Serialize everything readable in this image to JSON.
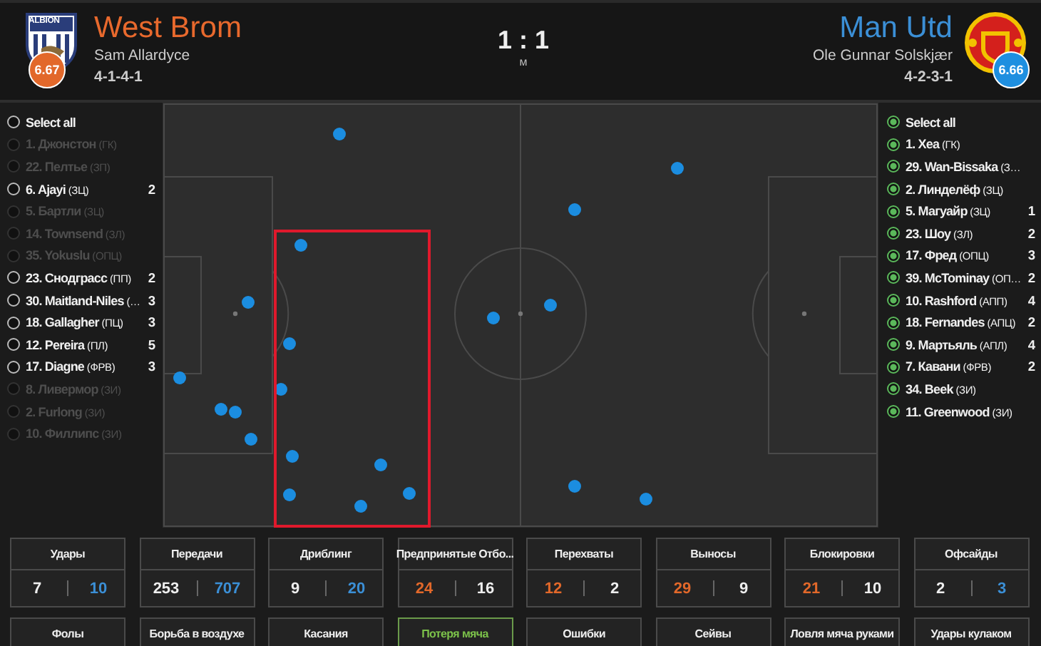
{
  "header": {
    "home": {
      "name": "West Brom",
      "coach": "Sam Allardyce",
      "formation": "4-1-4-1",
      "rating": "6.67",
      "logo_text": "ALBION"
    },
    "score": "1 : 1",
    "period": "м",
    "away": {
      "name": "Man Utd",
      "coach": "Ole Gunnar Solskjær",
      "formation": "4-2-3-1",
      "rating": "6.66"
    }
  },
  "home_players": [
    {
      "name": "Select all",
      "checked": false,
      "disabled": false
    },
    {
      "name": "1. Джонстон",
      "position": "(ГК)",
      "checked": false,
      "disabled": true
    },
    {
      "name": "22. Пелтье",
      "position": "(ЗП)",
      "checked": false,
      "disabled": true
    },
    {
      "name": "6. Ajayi",
      "position": "(ЗЦ)",
      "count": "2",
      "checked": false,
      "disabled": false
    },
    {
      "name": "5. Бартли",
      "position": "(ЗЦ)",
      "checked": false,
      "disabled": true
    },
    {
      "name": "14. Townsend",
      "position": "(ЗЛ)",
      "checked": false,
      "disabled": true
    },
    {
      "name": "35. Yokuslu",
      "position": "(ОПЦ)",
      "checked": false,
      "disabled": true
    },
    {
      "name": "23. Снодграсс",
      "position": "(ПП)",
      "count": "2",
      "checked": false,
      "disabled": false
    },
    {
      "name": "30. Maitland-Niles",
      "position": "(…",
      "count": "3",
      "checked": false,
      "disabled": false
    },
    {
      "name": "18. Gallagher",
      "position": "(ПЦ)",
      "count": "3",
      "checked": false,
      "disabled": false
    },
    {
      "name": "12. Pereira",
      "position": "(ПЛ)",
      "count": "5",
      "checked": false,
      "disabled": false
    },
    {
      "name": "17. Diagne",
      "position": "(ФРВ)",
      "count": "3",
      "checked": false,
      "disabled": false
    },
    {
      "name": "8. Ливермор",
      "position": "(ЗИ)",
      "checked": false,
      "disabled": true
    },
    {
      "name": "2. Furlong",
      "position": "(ЗИ)",
      "checked": false,
      "disabled": true
    },
    {
      "name": "10. Филлипс",
      "position": "(ЗИ)",
      "checked": false,
      "disabled": true
    }
  ],
  "away_players": [
    {
      "name": "Select all",
      "checked": true,
      "disabled": false
    },
    {
      "name": "1. Хеа",
      "position": "(ГК)",
      "checked": true,
      "disabled": false
    },
    {
      "name": "29. Wan-Bissaka",
      "position": "(З…",
      "checked": true,
      "disabled": false
    },
    {
      "name": "2. Линделёф",
      "position": "(ЗЦ)",
      "checked": true,
      "disabled": false
    },
    {
      "name": "5. Магуайр",
      "position": "(ЗЦ)",
      "count": "1",
      "checked": true,
      "disabled": false
    },
    {
      "name": "23. Шоу",
      "position": "(ЗЛ)",
      "count": "2",
      "checked": true,
      "disabled": false
    },
    {
      "name": "17. Фред",
      "position": "(ОПЦ)",
      "count": "3",
      "checked": true,
      "disabled": false
    },
    {
      "name": "39. McTominay",
      "position": "(ОП…",
      "count": "2",
      "checked": true,
      "disabled": false
    },
    {
      "name": "10. Rashford",
      "position": "(АПП)",
      "count": "4",
      "checked": true,
      "disabled": false
    },
    {
      "name": "18. Fernandes",
      "position": "(АПЦ)",
      "count": "2",
      "checked": true,
      "disabled": false
    },
    {
      "name": "9. Мартьяль",
      "position": "(АПЛ)",
      "count": "4",
      "checked": true,
      "disabled": false
    },
    {
      "name": "7. Кавани",
      "position": "(ФРВ)",
      "count": "2",
      "checked": true,
      "disabled": false
    },
    {
      "name": "34. Beek",
      "position": "(ЗИ)",
      "checked": true,
      "disabled": false
    },
    {
      "name": "11. Greenwood",
      "position": "(ЗИ)",
      "checked": true,
      "disabled": false
    }
  ],
  "stats": [
    {
      "title": "Удары",
      "home": "7",
      "away": "10",
      "home_lead": false,
      "away_lead": true,
      "selected": false
    },
    {
      "title": "Передачи",
      "home": "253",
      "away": "707",
      "home_lead": false,
      "away_lead": true,
      "selected": false
    },
    {
      "title": "Дриблинг",
      "home": "9",
      "away": "20",
      "home_lead": false,
      "away_lead": true,
      "selected": false
    },
    {
      "title": "Предпринятые Отбо...",
      "home": "24",
      "away": "16",
      "home_lead": true,
      "away_lead": false,
      "selected": false
    },
    {
      "title": "Перехваты",
      "home": "12",
      "away": "2",
      "home_lead": true,
      "away_lead": false,
      "selected": false
    },
    {
      "title": "Выносы",
      "home": "29",
      "away": "9",
      "home_lead": true,
      "away_lead": false,
      "selected": false
    },
    {
      "title": "Блокировки",
      "home": "21",
      "away": "10",
      "home_lead": true,
      "away_lead": false,
      "selected": false
    },
    {
      "title": "Офсайды",
      "home": "2",
      "away": "3",
      "home_lead": false,
      "away_lead": true,
      "selected": false
    },
    {
      "title": "Фолы",
      "selected": false
    },
    {
      "title": "Борьба в воздухе",
      "selected": false
    },
    {
      "title": "Касания",
      "selected": false
    },
    {
      "title": "Потеря мяча",
      "selected": true
    },
    {
      "title": "Ошибки",
      "selected": false
    },
    {
      "title": "Сейвы",
      "selected": false
    },
    {
      "title": "Ловля мяча руками",
      "selected": false
    },
    {
      "title": "Удары кулаком",
      "selected": false
    }
  ]
}
